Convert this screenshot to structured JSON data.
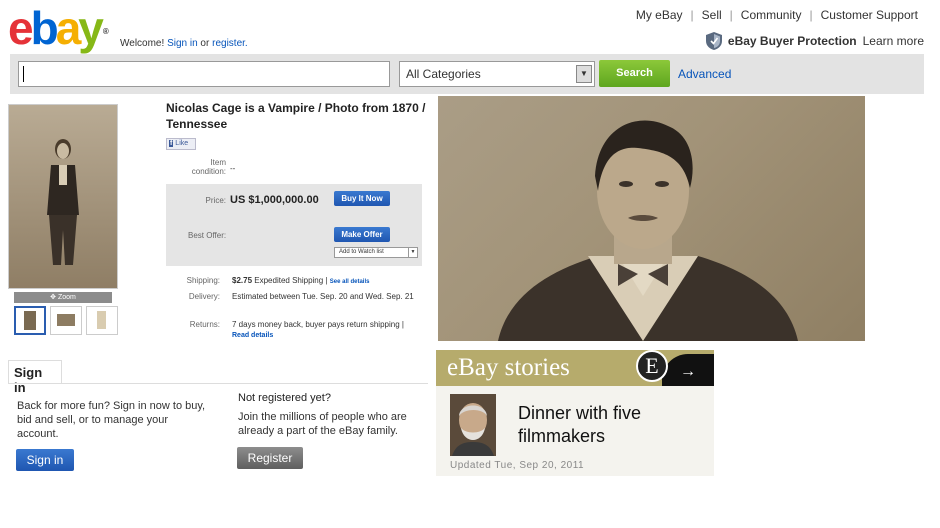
{
  "header": {
    "logo_letters": [
      "e",
      "b",
      "a",
      "y"
    ],
    "welcome_prefix": "Welcome!",
    "sign_in_link": "Sign in",
    "or_text": "or",
    "register_link": "register.",
    "nav": [
      "My eBay",
      "Sell",
      "Community",
      "Customer Support"
    ],
    "buyer_protection": "eBay Buyer Protection",
    "learn_more": "Learn more"
  },
  "search": {
    "value": "",
    "category": "All Categories",
    "button": "Search",
    "advanced": "Advanced"
  },
  "listing": {
    "title": "Nicolas Cage is a Vampire / Photo from 1870 / Tennessee",
    "like_label": "Like",
    "zoom_label": "Zoom",
    "item_condition_label": "Item condition:",
    "item_condition_value": "--",
    "price_label": "Price:",
    "price_value": "US $1,000,000.00",
    "buy_it_now": "Buy It Now",
    "best_offer_label": "Best Offer:",
    "make_offer": "Make Offer",
    "add_to_watch_list": "Add to Watch list",
    "shipping_label": "Shipping:",
    "shipping_cost": "$2.75",
    "shipping_method": "Expedited Shipping",
    "see_all_details": "See all details",
    "delivery_label": "Delivery:",
    "delivery_value": "Estimated between Tue. Sep. 20 and Wed. Sep. 21",
    "returns_label": "Returns:",
    "returns_value": "7 days money back, buyer pays return shipping",
    "read_details": "Read details"
  },
  "signin": {
    "heading": "Sign in",
    "text": "Back for more fun? Sign in now to buy, bid and sell, or to manage your account.",
    "button": "Sign in",
    "not_registered": "Not registered yet?",
    "join_text": "Join the millions of people who are already a part of the eBay family.",
    "register_button": "Register"
  },
  "stories": {
    "heading": "eBay stories",
    "badge_letter": "E",
    "arrow": "→",
    "title": "Dinner with five filmmakers",
    "updated": "Updated Tue, Sep 20, 2011"
  },
  "colors": {
    "ebay_red": "#e53238",
    "ebay_blue": "#0064d2",
    "ebay_yellow": "#f5af02",
    "ebay_green": "#86b817",
    "link_blue": "#0654ba",
    "search_green": "#6cb02a"
  },
  "icons": {
    "shield": "shield-icon",
    "dropdown": "chevron-down-icon",
    "zoom": "zoom-icon"
  }
}
